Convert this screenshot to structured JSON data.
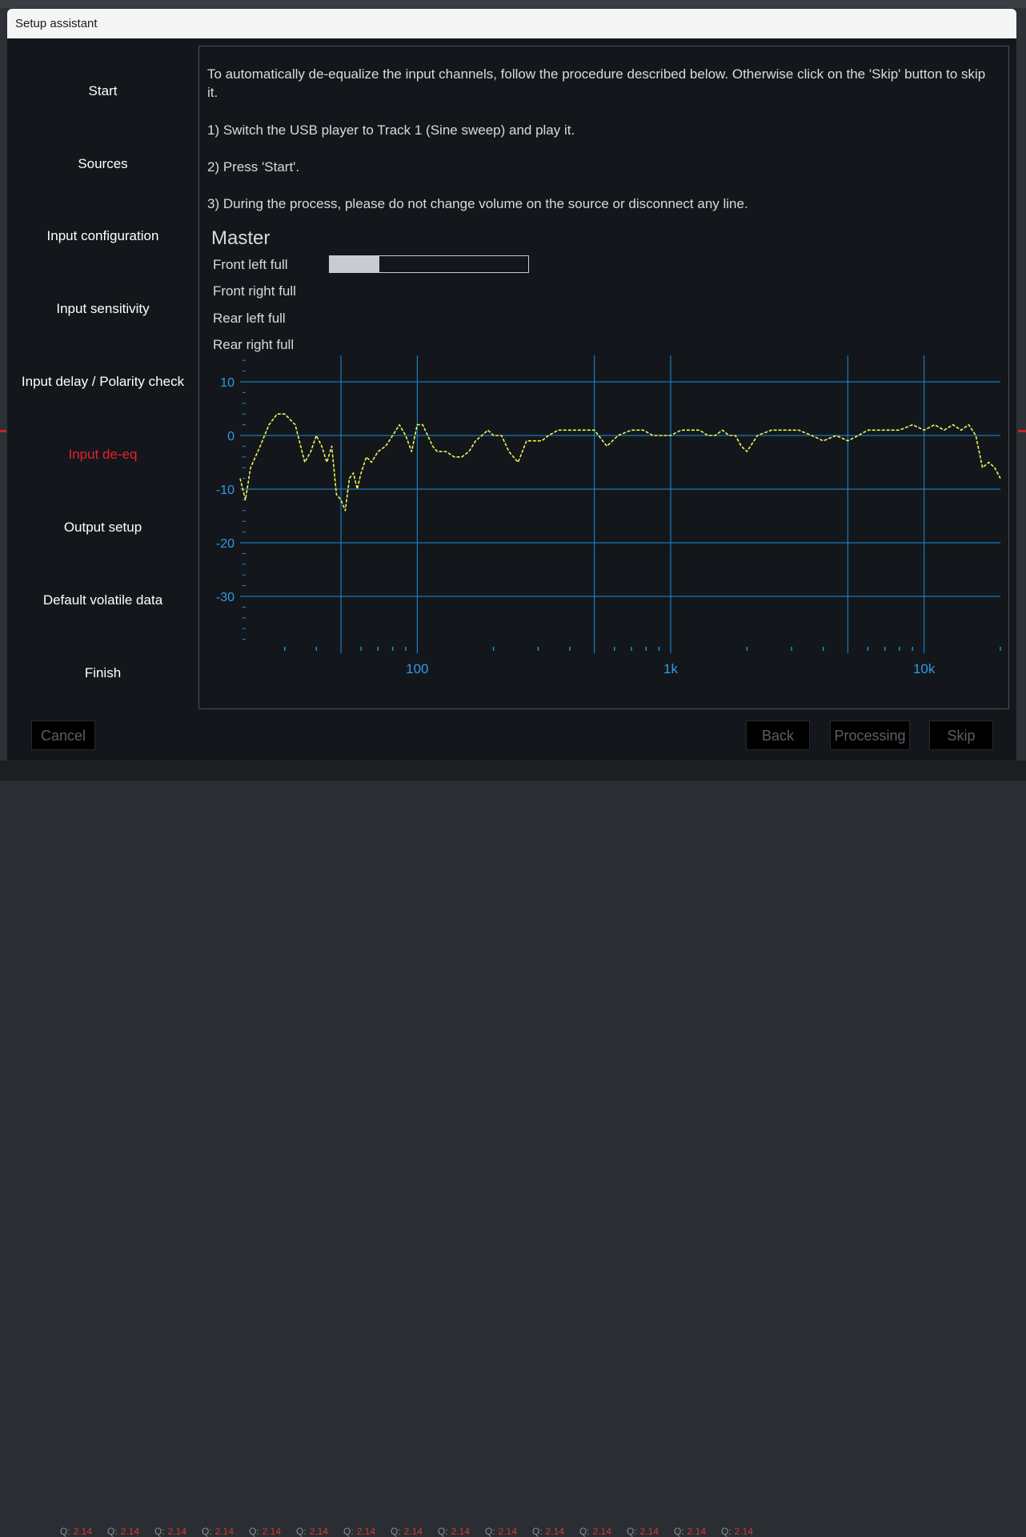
{
  "dialog": {
    "title": "Setup assistant"
  },
  "nav": {
    "items": [
      {
        "label": "Start",
        "active": false
      },
      {
        "label": "Sources",
        "active": false
      },
      {
        "label": "Input configuration",
        "active": false
      },
      {
        "label": "Input sensitivity",
        "active": false
      },
      {
        "label": "Input delay / Polarity check",
        "active": false
      },
      {
        "label": "Input de-eq",
        "active": true
      },
      {
        "label": "Output setup",
        "active": false
      },
      {
        "label": "Default volatile data",
        "active": false
      },
      {
        "label": "Finish",
        "active": false
      }
    ]
  },
  "instructions": {
    "intro": "To automatically de-equalize the input channels, follow the procedure described below. Otherwise click on the 'Skip' button to skip it.",
    "step1": "1) Switch the USB player to Track 1 (Sine sweep) and play it.",
    "step2": "2) Press 'Start'.",
    "step3": "3) During the process, please do not change volume on the source or disconnect any line."
  },
  "master": {
    "title": "Master",
    "channels": [
      "Front left full",
      "Front right full",
      "Rear left full",
      "Rear right full"
    ],
    "progress": 0.25
  },
  "chart_data": {
    "type": "line",
    "x_scale": "log",
    "xlim": [
      20,
      20000
    ],
    "ylim": [
      -40,
      15
    ],
    "x_tick_labels": [
      "100",
      "1k",
      "10k"
    ],
    "y_tick_labels": [
      "10",
      "0",
      "-10",
      "-20",
      "-30"
    ],
    "grid": true,
    "series": [
      {
        "color": "#f2f25a",
        "x": [
          20,
          21,
          22,
          24,
          26,
          28,
          30,
          33,
          36,
          38,
          40,
          42,
          44,
          46,
          48,
          50,
          52,
          54,
          56,
          58,
          60,
          63,
          66,
          70,
          75,
          80,
          85,
          90,
          95,
          100,
          105,
          110,
          115,
          120,
          130,
          140,
          150,
          160,
          170,
          180,
          190,
          200,
          215,
          230,
          250,
          270,
          290,
          310,
          330,
          360,
          400,
          450,
          500,
          560,
          620,
          700,
          780,
          850,
          930,
          1000,
          1100,
          1200,
          1300,
          1400,
          1500,
          1600,
          1700,
          1800,
          1900,
          2000,
          2200,
          2500,
          2800,
          3200,
          3600,
          4000,
          4500,
          5000,
          5500,
          6000,
          6500,
          7000,
          8000,
          9000,
          10000,
          11000,
          12000,
          13000,
          14000,
          15000,
          16000,
          17000,
          18000,
          19000,
          20000
        ],
        "y": [
          -8,
          -12,
          -6,
          -2,
          2,
          4,
          4,
          2,
          -5,
          -3,
          0,
          -2,
          -5,
          -2,
          -11,
          -12,
          -14,
          -8,
          -7,
          -10,
          -7,
          -4,
          -5,
          -3,
          -2,
          0,
          2,
          0,
          -3,
          2,
          2,
          0,
          -2,
          -3,
          -3,
          -4,
          -4,
          -3,
          -1,
          0,
          1,
          0,
          0,
          -3,
          -5,
          -1,
          -1,
          -1,
          0,
          1,
          1,
          1,
          1,
          -2,
          0,
          1,
          1,
          0,
          0,
          0,
          1,
          1,
          1,
          0,
          0,
          1,
          0,
          0,
          -2,
          -3,
          0,
          1,
          1,
          1,
          0,
          -1,
          0,
          -1,
          0,
          1,
          1,
          1,
          1,
          2,
          1,
          2,
          1,
          2,
          1,
          2,
          0,
          -6,
          -5,
          -6,
          -8
        ]
      }
    ]
  },
  "buttons": {
    "cancel": "Cancel",
    "back": "Back",
    "processing": "Processing",
    "skip": "Skip"
  },
  "background": {
    "q_label": "Q:",
    "q_value": "2.14"
  }
}
